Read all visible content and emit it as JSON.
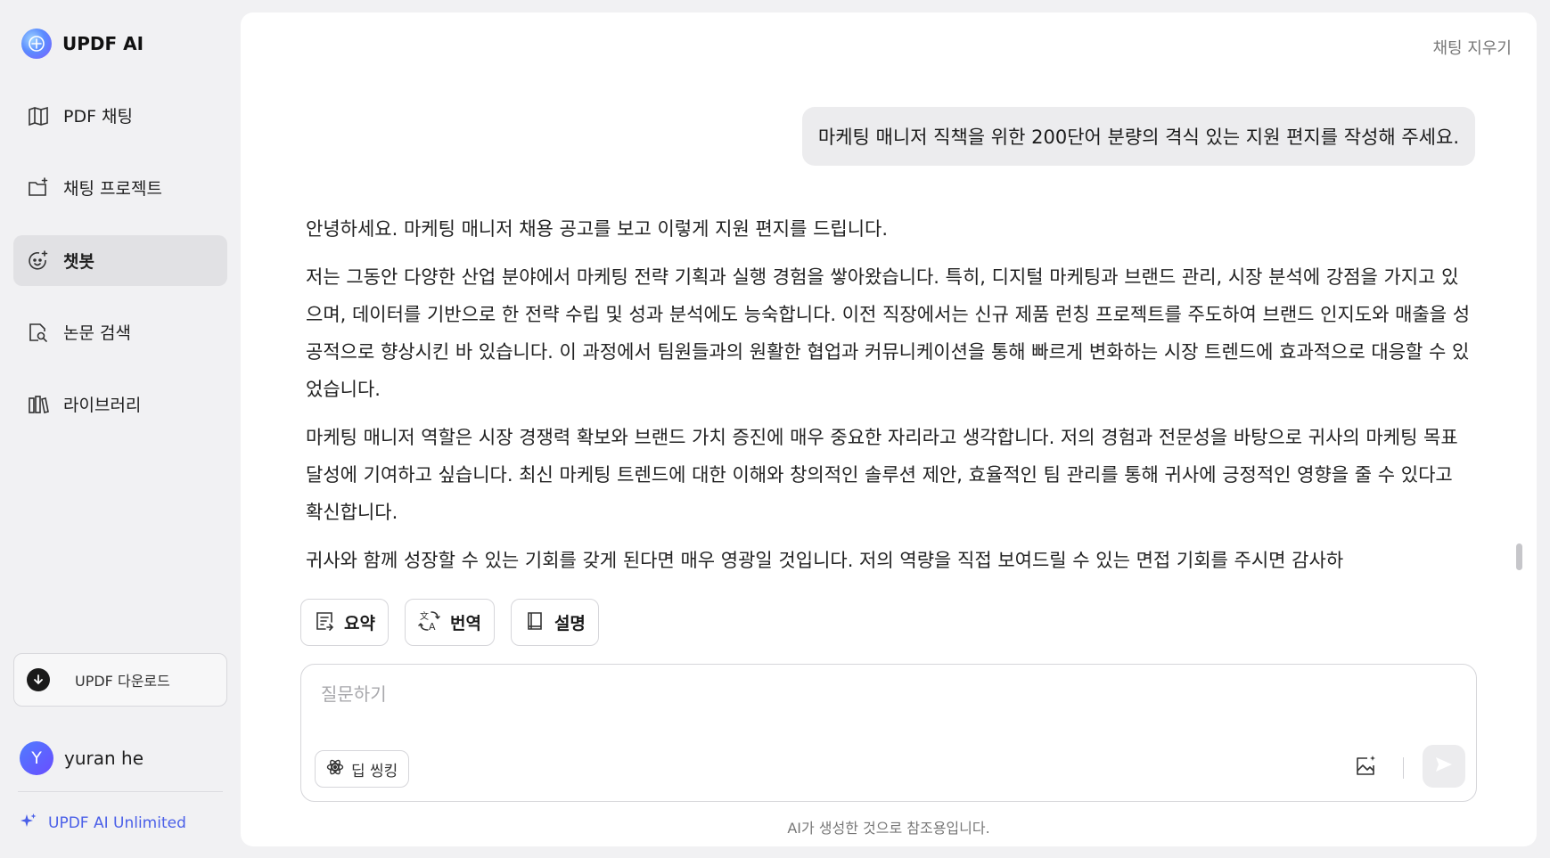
{
  "sidebar": {
    "brand": "UPDF AI",
    "items": [
      {
        "label": "PDF 채팅",
        "icon": "book-map-icon"
      },
      {
        "label": "채팅 프로젝트",
        "icon": "folder-add-icon"
      },
      {
        "label": "챗봇",
        "icon": "chatbot-face-icon"
      },
      {
        "label": "논문 검색",
        "icon": "paper-search-icon"
      },
      {
        "label": "라이브러리",
        "icon": "library-icon"
      }
    ],
    "download_label": "UPDF 다운로드",
    "user": {
      "initial": "Y",
      "name": "yuran he"
    },
    "unlimited_label": "UPDF AI Unlimited"
  },
  "header": {
    "clear_chat": "채팅 지우기"
  },
  "chat": {
    "user_message": "마케팅 매니저 직책을 위한 200단어 분량의 격식 있는 지원 편지를 작성해 주세요.",
    "answer": [
      "안녕하세요. 마케팅 매니저 채용 공고를 보고 이렇게 지원 편지를 드립니다.",
      "저는 그동안 다양한 산업 분야에서 마케팅 전략 기획과 실행 경험을 쌓아왔습니다. 특히, 디지털 마케팅과 브랜드 관리, 시장 분석에 강점을 가지고 있으며, 데이터를 기반으로 한 전략 수립 및 성과 분석에도 능숙합니다. 이전 직장에서는 신규 제품 런칭 프로젝트를 주도하여 브랜드 인지도와 매출을 성공적으로 향상시킨 바 있습니다. 이 과정에서 팀원들과의 원활한 협업과 커뮤니케이션을 통해 빠르게 변화하는 시장 트렌드에 효과적으로 대응할 수 있었습니다.",
      "마케팅 매니저 역할은 시장 경쟁력 확보와 브랜드 가치 증진에 매우 중요한 자리라고 생각합니다. 저의 경험과 전문성을 바탕으로 귀사의 마케팅 목표 달성에 기여하고 싶습니다. 최신 마케팅 트렌드에 대한 이해와 창의적인 솔루션 제안, 효율적인 팀 관리를 통해 귀사에 긍정적인 영향을 줄 수 있다고 확신합니다.",
      "귀사와 함께 성장할 수 있는 기회를 갖게 된다면 매우 영광일 것입니다. 저의 역량을 직접 보여드릴 수 있는 면접 기회를 주시면 감사하"
    ],
    "actions": [
      {
        "label": "요약",
        "icon": "summary-icon"
      },
      {
        "label": "번역",
        "icon": "translate-icon"
      },
      {
        "label": "설명",
        "icon": "explain-book-icon"
      }
    ]
  },
  "input": {
    "placeholder": "질문하기",
    "deep_think_label": "딥 씽킹"
  },
  "footer": {
    "disclaimer": "AI가 생성한 것으로 참조용입니다."
  },
  "colors": {
    "accent": "#4a5fe8",
    "active_nav": "#e1e1e4",
    "background": "#f1f1f3"
  }
}
